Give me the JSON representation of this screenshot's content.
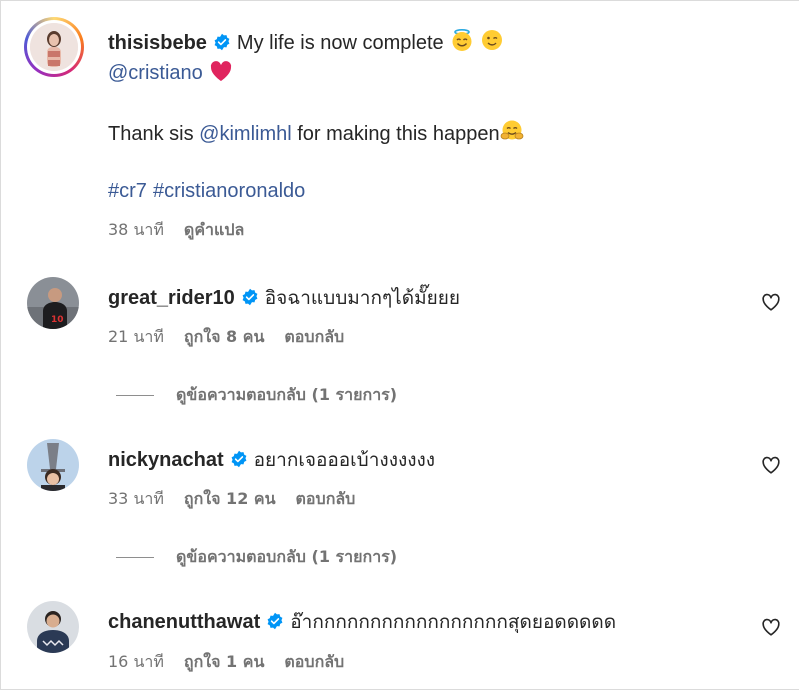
{
  "post": {
    "username": "thisisbebe",
    "caption_line1": "My life is now complete",
    "mention_cristiano": "@cristiano",
    "caption_line3_pre": "Thank sis ",
    "mention_kim": "@kimlimhl",
    "caption_line3_post": " for making this happen",
    "hashtag1": "#cr7",
    "hashtag2": "#cristianoronaldo",
    "time": "38 นาที",
    "translate": "ดูคำแปล"
  },
  "comments": [
    {
      "username": "great_rider10",
      "text": "อิจฉาแบบมากๆได้มั๊ยยย",
      "time": "21 นาที",
      "likes": "ถูกใจ 8 คน",
      "reply": "ตอบกลับ",
      "view_replies": "ดูข้อความตอบกลับ (1 รายการ)"
    },
    {
      "username": "nickynachat",
      "text": "อยากเจอออเบ้างงงงงง",
      "time": "33 นาที",
      "likes": "ถูกใจ 12 คน",
      "reply": "ตอบกลับ",
      "view_replies": "ดูข้อความตอบกลับ (1 รายการ)"
    },
    {
      "username": "chanenutthawat",
      "text": "อ๊ากกกกกกกกกกกกกกกกกสุดยอดดดดด",
      "time": "16 นาที",
      "likes": "ถูกใจ 1 คน",
      "reply": "ตอบกลับ"
    }
  ],
  "colors": {
    "link": "#3b5a95",
    "verified": "#0095f6",
    "meta": "#737373",
    "heart_red": "#e0245e"
  },
  "icons": [
    "verified-badge-icon",
    "heart-outline-icon",
    "halo-smile-emoji",
    "wink-emoji",
    "red-heart-emoji",
    "hug-emoji"
  ]
}
